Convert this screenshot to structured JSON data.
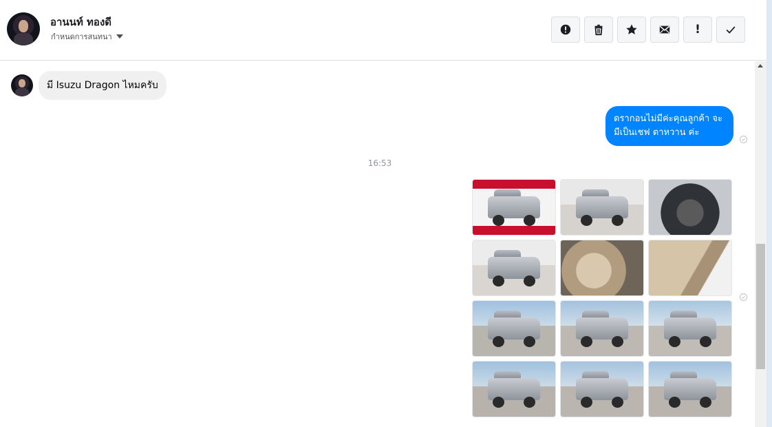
{
  "contact": {
    "name": "อานนท์ ทองดี",
    "subtitle": "กำหนดการสนทนา"
  },
  "actions": [
    {
      "name": "spam-icon",
      "label": ""
    },
    {
      "name": "trash-icon",
      "label": ""
    },
    {
      "name": "star-icon",
      "label": ""
    },
    {
      "name": "mail-icon",
      "label": ""
    },
    {
      "name": "mark-important-icon",
      "label": "!"
    },
    {
      "name": "check-icon",
      "label": ""
    }
  ],
  "messages": {
    "incoming_1": "มี Isuzu Dragon ไหมครับ",
    "outgoing_1": "ดรากอนไม่มีค่ะคุณลูกค้า จะมีเป็นเชฟ ตาหวาน ค่ะ",
    "timestamp": "16:53"
  },
  "gallery": {
    "images": [
      {
        "name": "photo-promo-front",
        "kind": "promo"
      },
      {
        "name": "photo-front-showroom",
        "kind": "showroom"
      },
      {
        "name": "photo-engine-bay",
        "kind": "engine"
      },
      {
        "name": "photo-front-angle",
        "kind": "showroom"
      },
      {
        "name": "photo-interior-seats",
        "kind": "interior"
      },
      {
        "name": "photo-door-panel",
        "kind": "door"
      },
      {
        "name": "photo-outdoor-front",
        "kind": "outdoor"
      },
      {
        "name": "photo-outdoor-rear",
        "kind": "outdoor"
      },
      {
        "name": "photo-outdoor-side",
        "kind": "outdoor"
      },
      {
        "name": "photo-outdoor-rear-angle",
        "kind": "outdoor"
      },
      {
        "name": "photo-outdoor-rear-center",
        "kind": "outdoor"
      },
      {
        "name": "photo-outdoor-front-center",
        "kind": "outdoor"
      }
    ]
  },
  "colors": {
    "outgoing_bubble": "#0084ff",
    "incoming_bubble": "#f0f0f0",
    "timestamp": "#8d949e"
  }
}
